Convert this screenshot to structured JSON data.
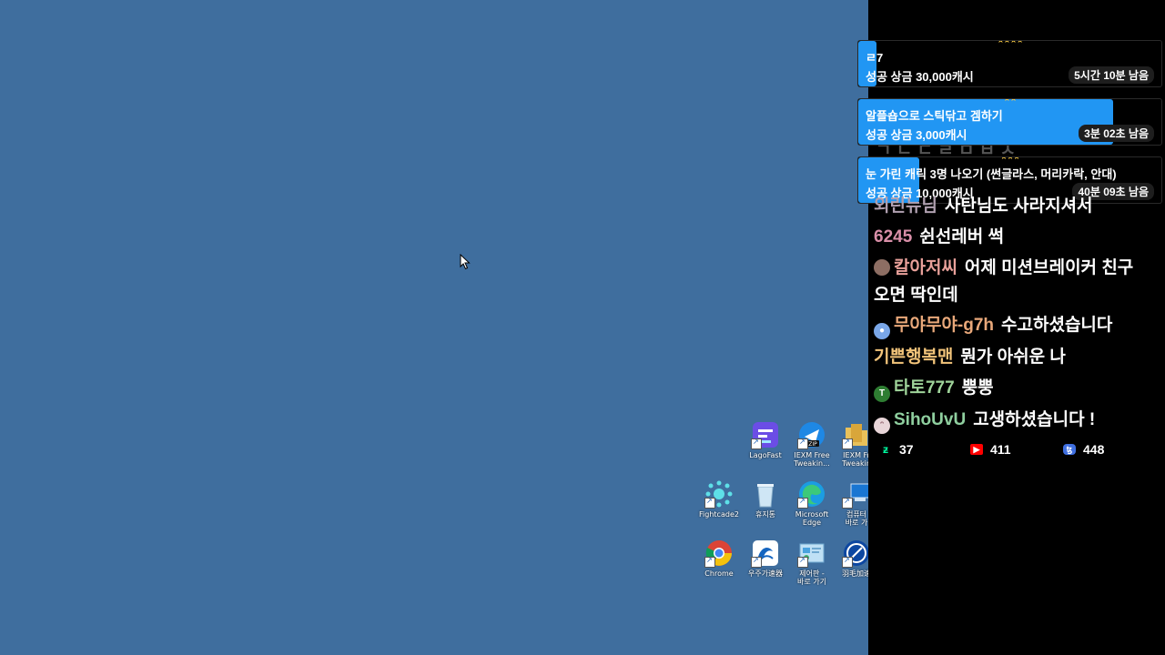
{
  "desktop": {
    "background": "#3f6e9e",
    "icons": [
      {
        "label": "LagoFast",
        "icon": "lagofast-icon"
      },
      {
        "label": "IEXM Free\nTweakin...",
        "icon": "zip-icon"
      },
      {
        "label": "IEXM Fr\nTweakin",
        "icon": "folder-icon"
      },
      {
        "label": "Fightcade2",
        "icon": "fightcade-icon"
      },
      {
        "label": "휴지통",
        "icon": "recycle-bin-icon"
      },
      {
        "label": "Microsoft\nEdge",
        "icon": "edge-icon"
      },
      {
        "label": "컴퓨터\n바로 가",
        "icon": "computer-icon"
      },
      {
        "label": "Chrome",
        "icon": "chrome-icon"
      },
      {
        "label": "우주가速器",
        "icon": "accelerator-icon"
      },
      {
        "label": "제어판 -\n바로 가기",
        "icon": "control-panel-icon"
      },
      {
        "label": "羽毛加速",
        "icon": "network-icon"
      }
    ]
  },
  "missions": [
    {
      "stars": "★★★★",
      "title": "ㄹ7",
      "reward": "성공 상금 30,000캐시",
      "time": "5시간 10분 남음",
      "progress": 0.06
    },
    {
      "stars": "★★",
      "title": "알플숍으로 스틱닦고 겜하기",
      "reward": "성공 상금 3,000캐시",
      "time": "3분 02초 남음",
      "progress": 0.84
    },
    {
      "stars": "★★★",
      "title": "눈 가린 캐릭 3명 나오기 (썬글라스, 머리카락, 안대)",
      "reward": "성공 상금 10,000캐시",
      "time": "40분 09초 남음",
      "progress": 0.2
    }
  ],
  "chat": [
    {
      "nick": "외린뉴님",
      "message": "사탄님도 사라지셔서",
      "nick_color": "#b0a0b0",
      "avatar": ""
    },
    {
      "nick": "6245",
      "message": "쉰선레버 썩",
      "nick_color": "#d98fa8",
      "avatar": ""
    },
    {
      "nick": "칼아저씨",
      "message": "어제 미션브레이커 친구 오면 딱인데",
      "nick_color": "#e8a09a",
      "avatar": "photo"
    },
    {
      "nick": "무야무야-g7h",
      "message": "수고하셨습니다",
      "nick_color": "#e9a87a",
      "avatar": "person"
    },
    {
      "nick": "기쁜행복맨",
      "message": "뭔가 아쉬운 나",
      "nick_color": "#f2c47a",
      "avatar": ""
    },
    {
      "nick": "타토777",
      "message": "뿡뿡",
      "nick_color": "#9fd49a",
      "avatar": "T"
    },
    {
      "nick": "SihoUvU",
      "message": "고생하셨습니다 !",
      "nick_color": "#8fcf9f",
      "avatar": "cat"
    }
  ],
  "stats": [
    {
      "platform": "chzzk",
      "icon": "chzzk-icon",
      "count": "37",
      "color": "#00ffa3"
    },
    {
      "platform": "youtube",
      "icon": "youtube-icon",
      "count": "411",
      "color": "#ff0000"
    },
    {
      "platform": "soop",
      "icon": "soop-icon",
      "count": "448",
      "color": "#3f6fe0"
    }
  ]
}
